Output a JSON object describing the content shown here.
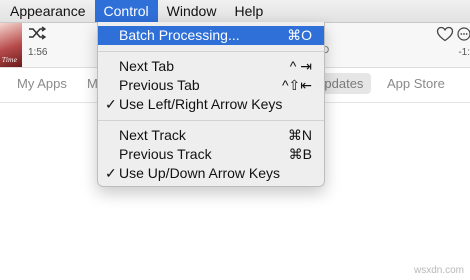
{
  "menubar": {
    "items": [
      {
        "label": "Appearance"
      },
      {
        "label": "Control"
      },
      {
        "label": "Window"
      },
      {
        "label": "Help"
      }
    ]
  },
  "player": {
    "elapsed": "1:56",
    "remaining": "-1:",
    "track_fragment": "D",
    "album_tag": "Time"
  },
  "tabs": [
    "My Apps",
    "M",
    "Updates",
    "App Store"
  ],
  "control_menu": {
    "items": [
      {
        "label": "Batch Processing...",
        "shortcut": "⌘O",
        "checked": false,
        "highlighted": true
      },
      {
        "label": "Next Tab",
        "shortcut": "^ ⇥",
        "checked": false
      },
      {
        "label": "Previous Tab",
        "shortcut": "^⇧⇤",
        "checked": false
      },
      {
        "label": "Use Left/Right Arrow Keys",
        "shortcut": "",
        "checked": true
      },
      {
        "label": "Next Track",
        "shortcut": "⌘N",
        "checked": false
      },
      {
        "label": "Previous Track",
        "shortcut": "⌘B",
        "checked": false
      },
      {
        "label": "Use Up/Down Arrow Keys",
        "shortcut": "",
        "checked": true
      }
    ],
    "check_glyph": "✓"
  },
  "watermark": "wsxdn.com",
  "colors": {
    "menu_highlight": "#2f6fd8",
    "menubar_bg": "#e6e6e6",
    "dropdown_bg": "#eeeeee"
  }
}
